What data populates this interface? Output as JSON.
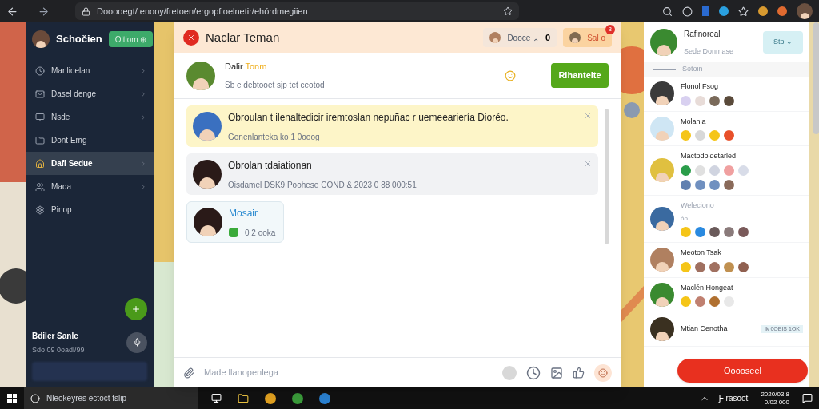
{
  "browser": {
    "url": "Dooooegt/ enooy/fretoen/ergopfioelnetir/ehórdmegiien"
  },
  "sidebar": {
    "profile_name": "Schočien",
    "profile_button": "Oltiom ⊕",
    "items": [
      {
        "label": "Manlioelan",
        "selected": false,
        "chevron": true
      },
      {
        "label": "Dasel denge",
        "selected": false,
        "chevron": true
      },
      {
        "label": "Nsde",
        "selected": false,
        "chevron": true
      },
      {
        "label": "Dont Emg",
        "selected": false,
        "chevron": false
      },
      {
        "label": "Dafi Sedue",
        "selected": true,
        "chevron": true
      },
      {
        "label": "Mada",
        "selected": false,
        "chevron": true
      },
      {
        "label": "Pinop",
        "selected": false,
        "chevron": false
      }
    ],
    "user_name": "Bdiler Sanle",
    "user_status": "Sdo 09 0oadl/99"
  },
  "chat": {
    "title": "Naclar Teman",
    "chip_1": {
      "label": "Dooce ⌅",
      "count": "0"
    },
    "chip_2": {
      "label": "Sal o",
      "badge": "3"
    },
    "contact": {
      "name": "Dalir",
      "highlight": "Tonm",
      "subtitle": "Sb e debtooet sjp tet ceotod",
      "button": "Rihantelte"
    },
    "messages": [
      {
        "kind": "highlight",
        "title": "Obroulan t ilenaltedicir iremtoslan nepuñac r uemeeariería Dioréo.",
        "subtitle": "Gonenlanteka ko 1 0ooog"
      },
      {
        "kind": "plain",
        "title": "Obrolan tdaiationan",
        "subtitle": "Oisdamel DSK9 Poohese COND & 2023 0 88 000:51"
      },
      {
        "kind": "mini",
        "title": "Mosair",
        "subtitle": "0 2 ooka"
      }
    ],
    "input": {
      "placeholder": "Made llanopenlega"
    }
  },
  "right_panel": {
    "name": "Rafinoreal",
    "status": "Sede Donmase",
    "button": "Sto ⌄",
    "section": "Sotoin",
    "contacts": [
      {
        "name": "Flonol Fsog",
        "dimmed": false,
        "reactions": [
          {
            "color": "#d8d0f0"
          },
          {
            "color": "#e8dcd8"
          },
          {
            "color": "#7a6a5a"
          },
          {
            "color": "#5a4a3a"
          }
        ]
      },
      {
        "name": "Molania",
        "dimmed": false,
        "reactions": [
          {
            "color": "#f5c518"
          },
          {
            "color": "#d8d8d8"
          },
          {
            "color": "#f5c518"
          },
          {
            "color": "#e8502a"
          }
        ]
      },
      {
        "name": "Mactodoldetarled",
        "dimmed": false,
        "reactions": [
          {
            "color": "#2a9d4a"
          },
          {
            "color": "#e0e0e0"
          },
          {
            "color": "#d0d4e0"
          },
          {
            "color": "#f0a0a0"
          },
          {
            "color": "#d8dce8"
          },
          {
            "color": "#6080b0"
          },
          {
            "color": "#7090c0"
          },
          {
            "color": "#7090c0"
          },
          {
            "color": "#8a6a5a"
          }
        ]
      },
      {
        "name": "Weleciono",
        "subtitle": "óo",
        "dimmed": true,
        "reactions": [
          {
            "color": "#f5c518"
          },
          {
            "color": "#2a8ae0"
          },
          {
            "color": "#6a5a5a"
          },
          {
            "color": "#8a7a7a"
          },
          {
            "color": "#7a5a5a"
          }
        ]
      },
      {
        "name": "Meoton Tsak",
        "dimmed": false,
        "reactions": [
          {
            "color": "#f5c518"
          },
          {
            "color": "#a07060"
          },
          {
            "color": "#a07060"
          },
          {
            "color": "#c09050"
          },
          {
            "color": "#906050"
          }
        ]
      },
      {
        "name": "Maclén Hongeat",
        "dimmed": false,
        "reactions": [
          {
            "color": "#f5c518"
          },
          {
            "color": "#c08070"
          },
          {
            "color": "#b07030"
          },
          {
            "color": "#e8e8e8"
          }
        ]
      },
      {
        "name": "Mtian Cenotha",
        "tag": "Ik 0OEIS 1OK",
        "dimmed": false
      }
    ],
    "action_button": "Ooooseel"
  },
  "taskbar": {
    "search": "Nleokeyres ectoct fslip",
    "tray": "Ƒ rasoot",
    "date": "2020/03 8",
    "time": "0/02 000"
  }
}
